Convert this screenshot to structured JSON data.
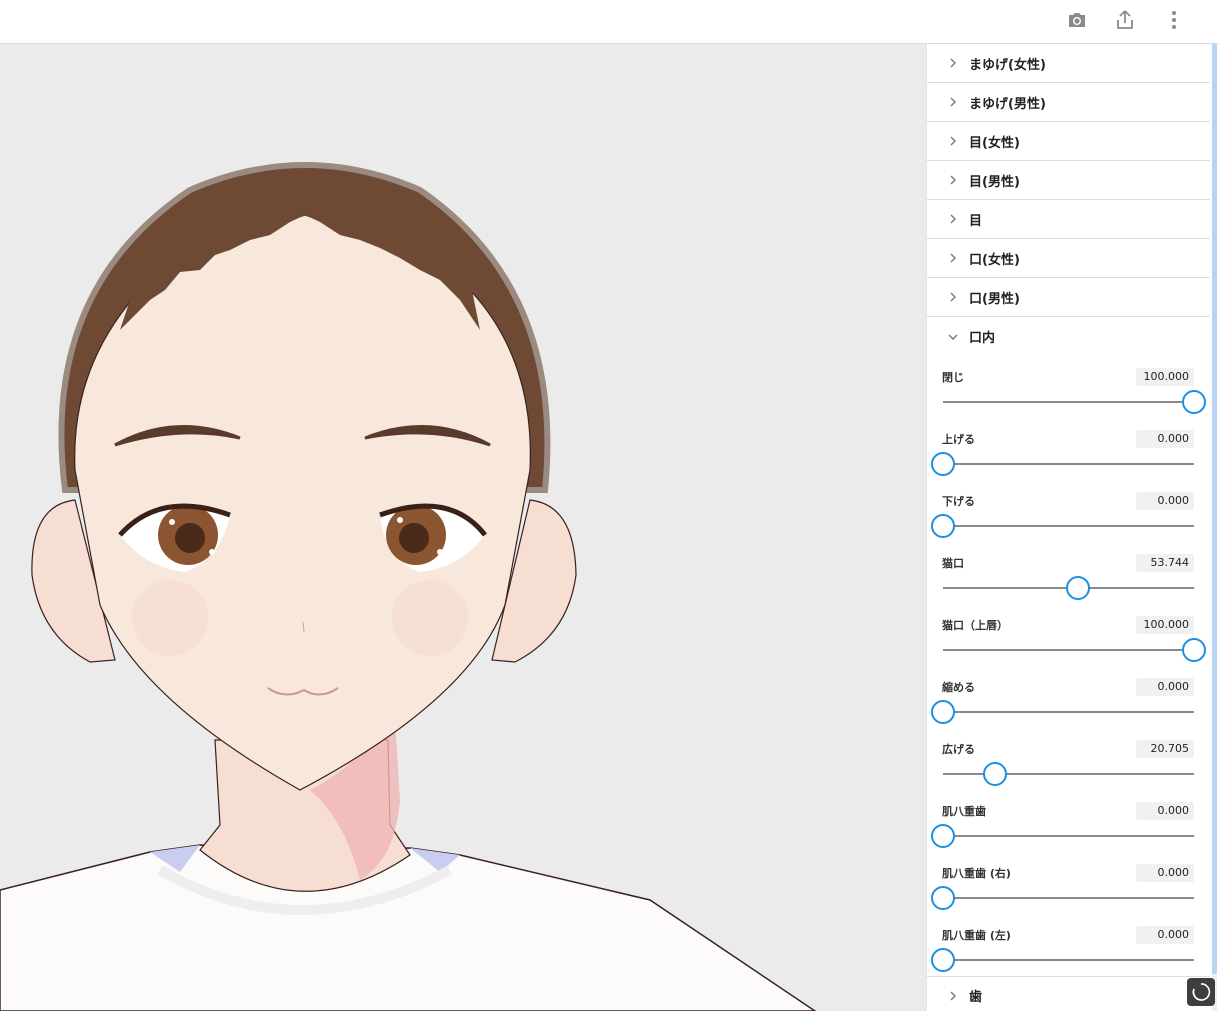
{
  "toolbar": {
    "camera_icon": "camera-icon",
    "share_icon": "share-icon",
    "more_icon": "more-vert-icon"
  },
  "panel": {
    "collapsed_sections": [
      {
        "label": "まゆげ(女性)"
      },
      {
        "label": "まゆげ(男性)"
      },
      {
        "label": "目(女性)"
      },
      {
        "label": "目(男性)"
      },
      {
        "label": "目"
      },
      {
        "label": "口(女性)"
      },
      {
        "label": "口(男性)"
      }
    ],
    "open_section": {
      "label": "口内",
      "sliders": [
        {
          "label": "閉じ",
          "value": "100.000",
          "percent": 100
        },
        {
          "label": "上げる",
          "value": "0.000",
          "percent": 0
        },
        {
          "label": "下げる",
          "value": "0.000",
          "percent": 0
        },
        {
          "label": "猫口",
          "value": "53.744",
          "percent": 53.744
        },
        {
          "label": "猫口（上唇）",
          "value": "100.000",
          "percent": 100
        },
        {
          "label": "縮める",
          "value": "0.000",
          "percent": 0
        },
        {
          "label": "広げる",
          "value": "20.705",
          "percent": 20.705
        },
        {
          "label": "肌八重歯",
          "value": "0.000",
          "percent": 0
        },
        {
          "label": "肌八重歯 (右)",
          "value": "0.000",
          "percent": 0
        },
        {
          "label": "肌八重歯 (左)",
          "value": "0.000",
          "percent": 0
        }
      ]
    },
    "next_section": {
      "label": "歯"
    }
  },
  "colors": {
    "accent": "#1a8fe3",
    "viewport_bg": "#ebebeb",
    "hair": "#6e4a35",
    "skin": "#f8e8dc"
  }
}
